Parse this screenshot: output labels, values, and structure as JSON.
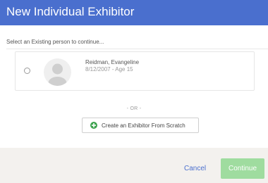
{
  "dialog": {
    "title": "New Individual Exhibitor",
    "prompt": "Select an Existing person to continue..."
  },
  "person": {
    "name": "Reidman, Evangeline",
    "meta": "8/12/2007 - Age 15",
    "selected": false,
    "avatar_icon": "person-placeholder-icon"
  },
  "separator": "- OR -",
  "create_button": {
    "label": "Create an Exhibitor From Scratch",
    "icon": "plus-circle-icon"
  },
  "footer": {
    "cancel_label": "Cancel",
    "continue_label": "Continue"
  },
  "colors": {
    "header": "#4a6fce",
    "accent_green": "#3ea34f",
    "continue_disabled": "#9fdc9f",
    "footer_bg": "#f3f1ee"
  }
}
